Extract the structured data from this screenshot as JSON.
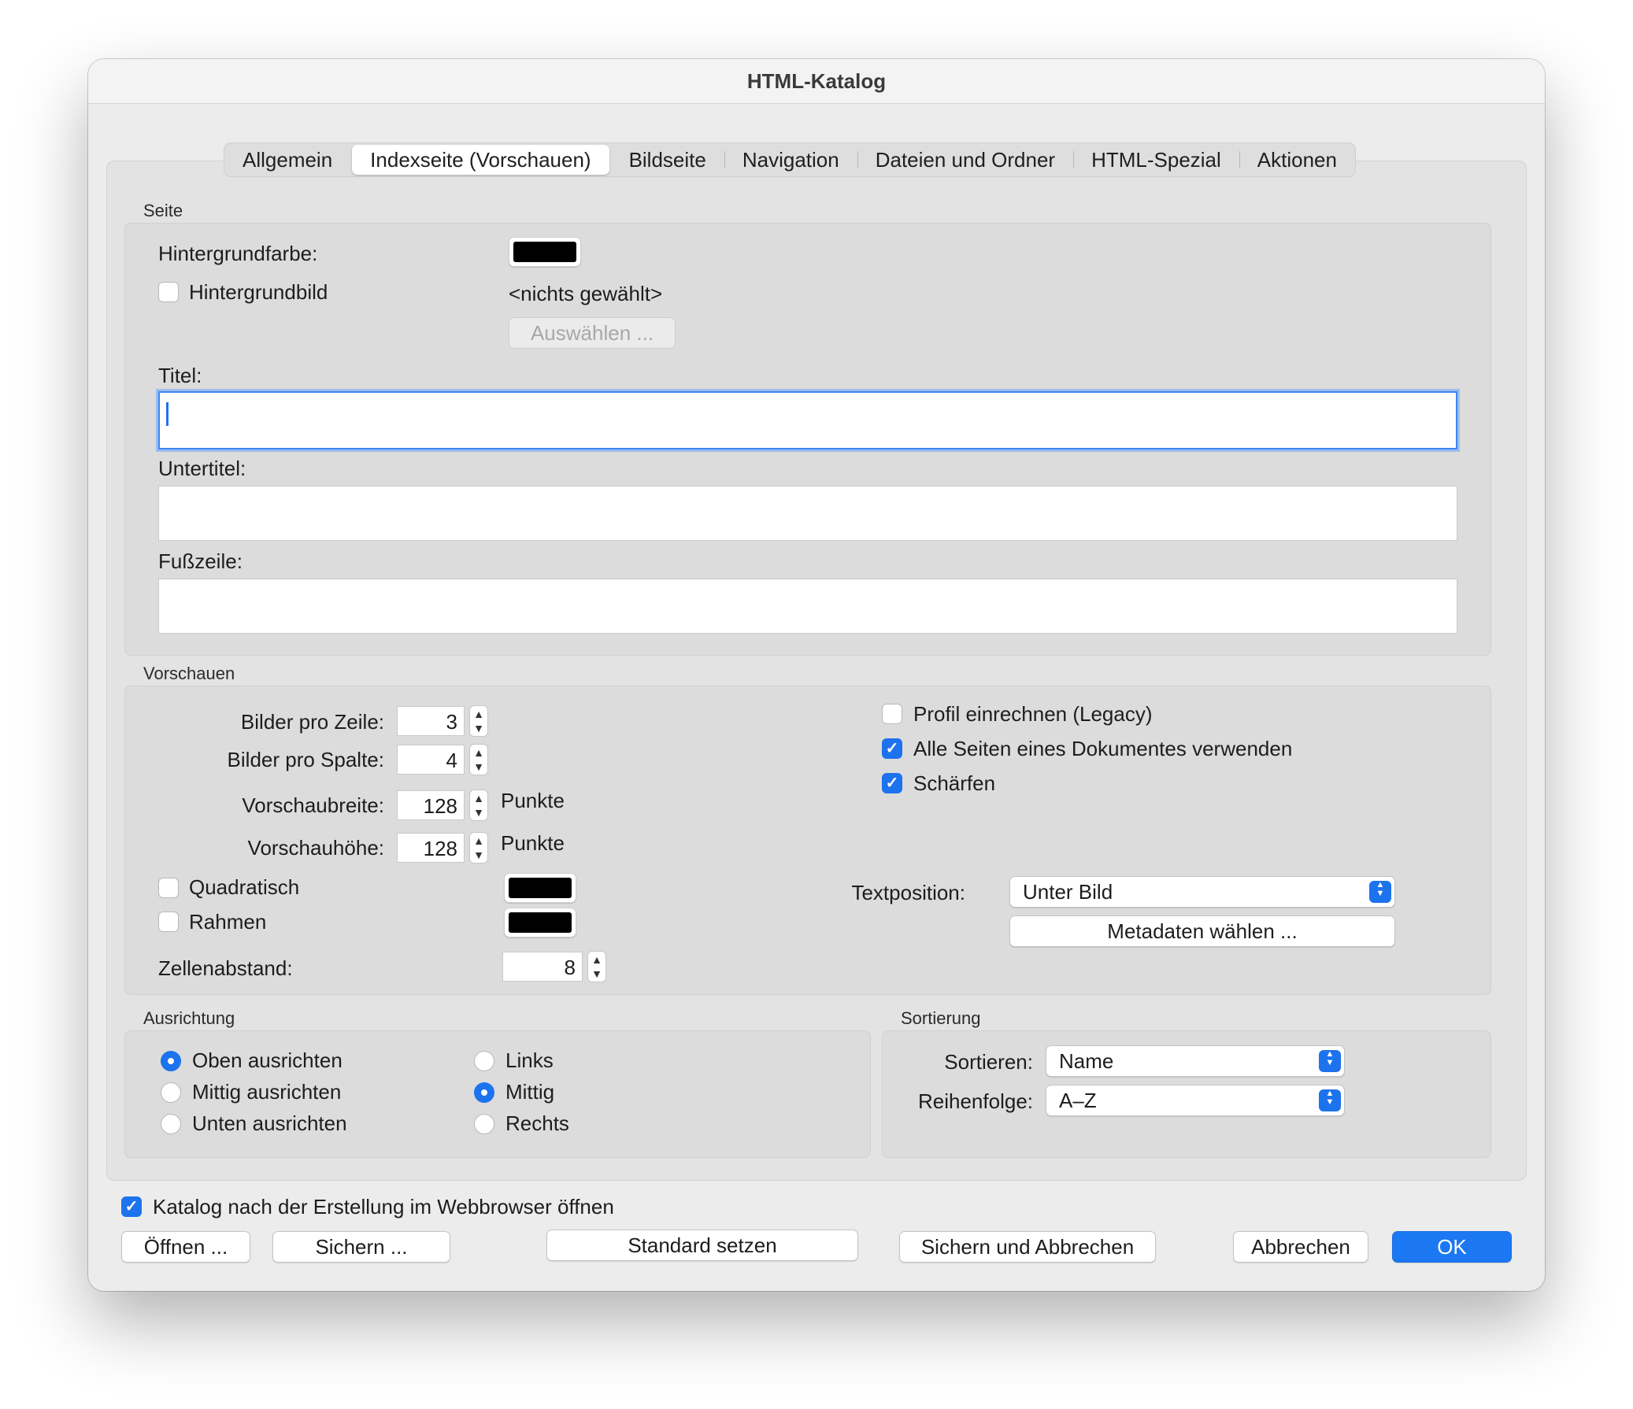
{
  "window": {
    "title": "HTML-Katalog"
  },
  "tabs": [
    {
      "label": "Allgemein",
      "active": false
    },
    {
      "label": "Indexseite (Vorschauen)",
      "active": true
    },
    {
      "label": "Bildseite",
      "active": false
    },
    {
      "label": "Navigation",
      "active": false
    },
    {
      "label": "Dateien und Ordner",
      "active": false
    },
    {
      "label": "HTML-Spezial",
      "active": false
    },
    {
      "label": "Aktionen",
      "active": false
    }
  ],
  "seite": {
    "label": "Seite",
    "hintergrundfarbe_label": "Hintergrundfarbe:",
    "hintergrundfarbe_color": "#000000",
    "hintergrundbild_label": "Hintergrundbild",
    "hintergrundbild_checked": false,
    "nichts_gewaehlt": "<nichts gewählt>",
    "auswaehlen_label": "Auswählen ...",
    "titel_label": "Titel:",
    "titel_value": "",
    "untertitel_label": "Untertitel:",
    "untertitel_value": "",
    "fusszeile_label": "Fußzeile:",
    "fusszeile_value": ""
  },
  "vorschauen": {
    "label": "Vorschauen",
    "bilder_pro_zeile_label": "Bilder pro Zeile:",
    "bilder_pro_zeile": "3",
    "bilder_pro_spalte_label": "Bilder pro Spalte:",
    "bilder_pro_spalte": "4",
    "vorschaubreite_label": "Vorschaubreite:",
    "vorschaubreite": "128",
    "vorschauhoehe_label": "Vorschauhöhe:",
    "vorschauhoehe": "128",
    "punkte": "Punkte",
    "quadratisch_label": "Quadratisch",
    "quadratisch_color": "#000000",
    "rahmen_label": "Rahmen",
    "rahmen_color": "#000000",
    "zellenabstand_label": "Zellenabstand:",
    "zellenabstand": "8",
    "profil_label": "Profil einrechnen (Legacy)",
    "alle_seiten_label": "Alle Seiten eines Dokumentes verwenden",
    "schaerfen_label": "Schärfen",
    "textposition_label": "Textposition:",
    "textposition_value": "Unter Bild",
    "metadaten_label": "Metadaten wählen ..."
  },
  "ausrichtung": {
    "label": "Ausrichtung",
    "oben": "Oben ausrichten",
    "mittig_v": "Mittig ausrichten",
    "unten": "Unten ausrichten",
    "links": "Links",
    "mittig_h": "Mittig",
    "rechts": "Rechts"
  },
  "sortierung": {
    "label": "Sortierung",
    "sortieren_label": "Sortieren:",
    "sortieren_value": "Name",
    "reihenfolge_label": "Reihenfolge:",
    "reihenfolge_value": "A–Z"
  },
  "footer": {
    "open_in_browser_label": "Katalog nach der Erstellung im Webbrowser öffnen",
    "oeffnen": "Öffnen ...",
    "sichern": "Sichern ...",
    "standard_setzen": "Standard setzen",
    "sichern_abbrechen": "Sichern und Abbrechen",
    "abbrechen": "Abbrechen",
    "ok": "OK"
  },
  "icons": {
    "checkmark": "checkmark-icon",
    "stepper_up": "chevron-up-icon",
    "stepper_down": "chevron-down-icon",
    "popup_arrows": "updown-chevron-icon"
  },
  "colors": {
    "accent": "#1d72ee"
  }
}
